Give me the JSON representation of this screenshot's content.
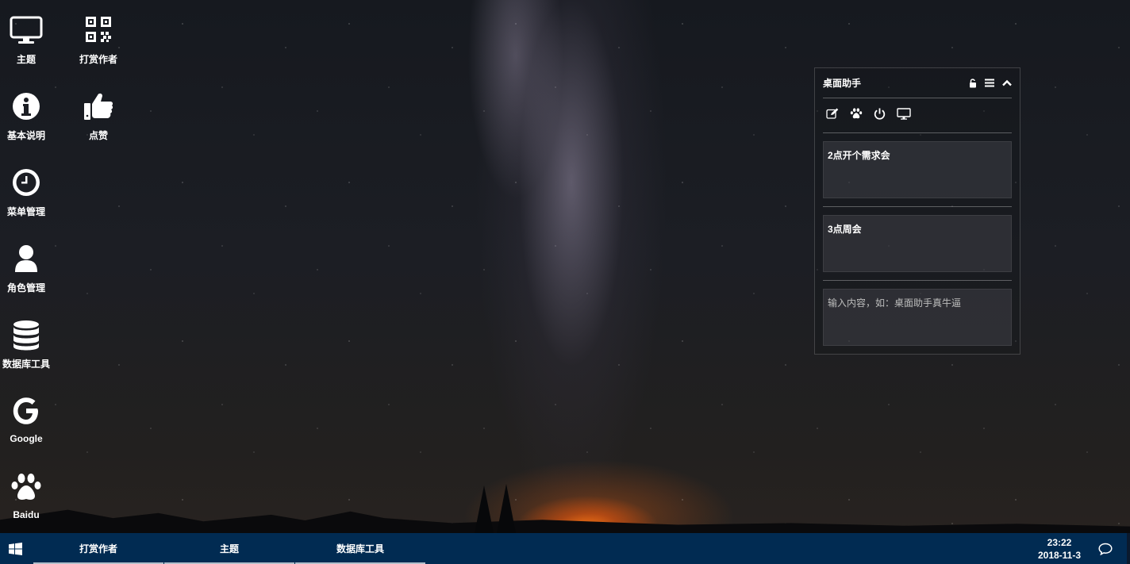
{
  "desktop_icons": [
    {
      "label": "主题",
      "icon": "monitor-icon"
    },
    {
      "label": "打赏作者",
      "icon": "qrcode-icon"
    },
    {
      "label": "基本说明",
      "icon": "info-icon"
    },
    {
      "label": "点赞",
      "icon": "thumbs-up-icon"
    },
    {
      "label": "菜单管理",
      "icon": "clock-icon"
    },
    {
      "label": "角色管理",
      "icon": "user-icon"
    },
    {
      "label": "数据库工具",
      "icon": "database-icon"
    },
    {
      "label": "Google",
      "icon": "google-icon"
    },
    {
      "label": "Baidu",
      "icon": "paw-icon"
    }
  ],
  "widget": {
    "title": "桌面助手",
    "header_icons": [
      "unlock-icon",
      "menu-icon",
      "chevron-up-icon"
    ],
    "tool_icons": [
      "edit-icon",
      "paw-icon",
      "power-icon",
      "monitor-icon"
    ],
    "notes": [
      {
        "value": "2点开个需求会"
      },
      {
        "value": "3点周会"
      }
    ],
    "new_note": {
      "value": "",
      "placeholder": "输入内容，如：桌面助手真牛逼"
    }
  },
  "taskbar": {
    "start_icon": "windows-icon",
    "items": [
      {
        "label": "打赏作者"
      },
      {
        "label": "主题"
      },
      {
        "label": "数据库工具"
      }
    ],
    "time": "23:22",
    "date": "2018-11-3",
    "message_icon": "message-icon"
  },
  "colors": {
    "taskbar": "#012b52",
    "sky": "#1c1e24",
    "horizon_glow": "#ff7814"
  }
}
